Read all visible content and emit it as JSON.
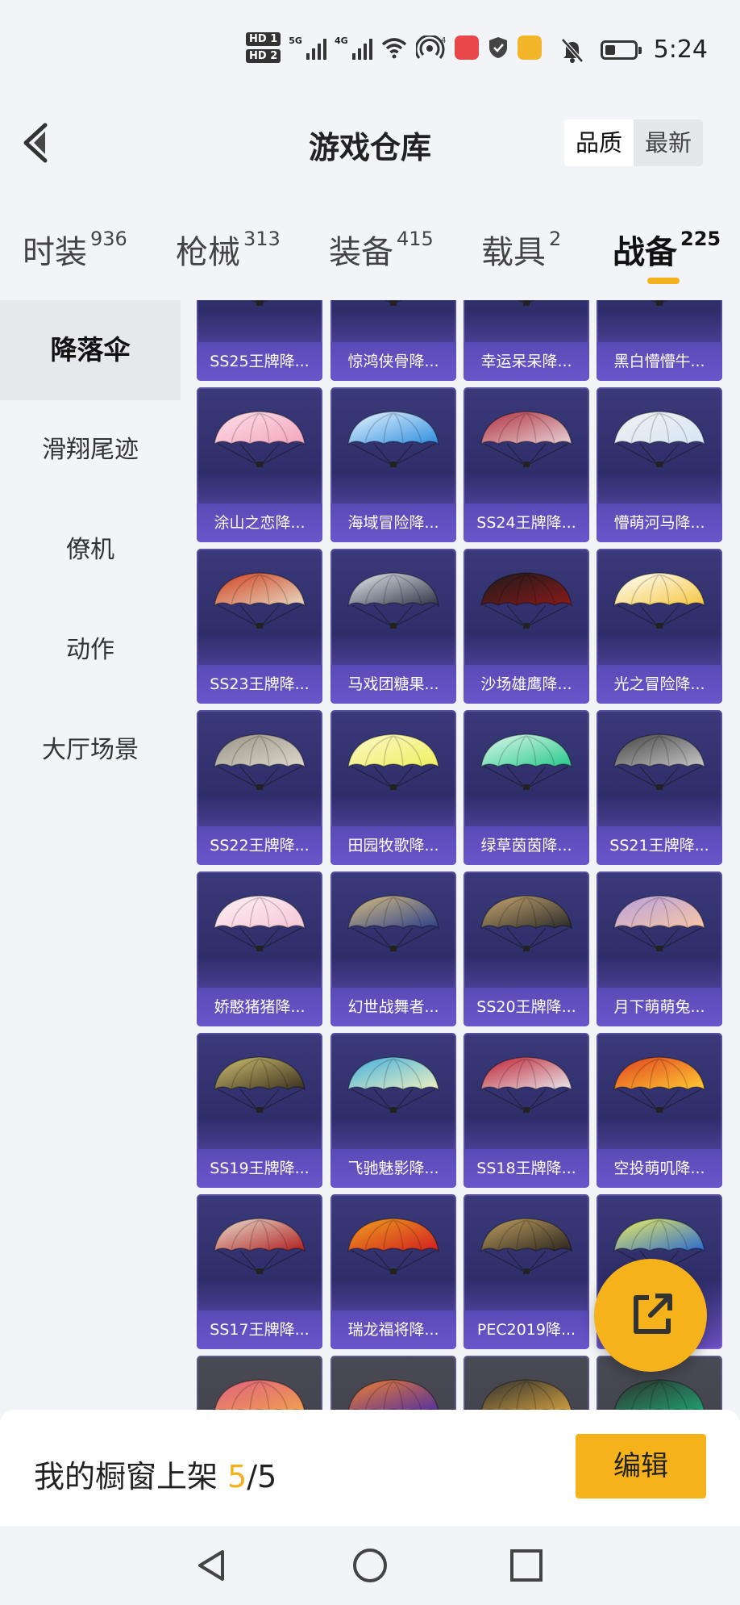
{
  "status_bar": {
    "time": "5:24",
    "hd1": "HD 1",
    "hd2": "HD 2",
    "net1": "5G",
    "net2": "4G"
  },
  "header": {
    "title": "游戏仓库",
    "sort": [
      "品质",
      "最新"
    ]
  },
  "tabs": [
    {
      "label": "时装",
      "count": "936"
    },
    {
      "label": "枪械",
      "count": "313"
    },
    {
      "label": "装备",
      "count": "415"
    },
    {
      "label": "载具",
      "count": "2"
    },
    {
      "label": "战备",
      "count": "225"
    }
  ],
  "side_menu": [
    "降落伞",
    "滑翔尾迹",
    "僚机",
    "动作",
    "大厅场景"
  ],
  "items": [
    {
      "name": "SS25王牌降...",
      "colors": [
        "#3a3a55",
        "#8a2030"
      ]
    },
    {
      "name": "惊鸿侠骨降...",
      "colors": [
        "#c02530",
        "#222"
      ]
    },
    {
      "name": "幸运呆呆降...",
      "colors": [
        "#e8e8e8",
        "#c04040"
      ]
    },
    {
      "name": "黑白懵懵牛...",
      "colors": [
        "#eee",
        "#222"
      ]
    },
    {
      "name": "涂山之恋降...",
      "colors": [
        "#f2a5bd",
        "#ffe0ea"
      ]
    },
    {
      "name": "海域冒险降...",
      "colors": [
        "#2f8fe0",
        "#eaf6ff"
      ]
    },
    {
      "name": "SS24王牌降...",
      "colors": [
        "#e9d3d6",
        "#b03040"
      ]
    },
    {
      "name": "懵萌河马降...",
      "colors": [
        "#d6e6f5",
        "#f1f1f1"
      ]
    },
    {
      "name": "SS23王牌降...",
      "colors": [
        "#e8d8c0",
        "#d04020"
      ]
    },
    {
      "name": "马戏团糖果...",
      "colors": [
        "#2c3545",
        "#e8ecf2"
      ]
    },
    {
      "name": "沙场雄鹰降...",
      "colors": [
        "#8a1a1a",
        "#1a1a1a"
      ]
    },
    {
      "name": "光之冒险降...",
      "colors": [
        "#f5c740",
        "#ffffff"
      ]
    },
    {
      "name": "SS22王牌降...",
      "colors": [
        "#ddd8cc",
        "#9a9488"
      ]
    },
    {
      "name": "田园牧歌降...",
      "colors": [
        "#eef060",
        "#fbf7c8"
      ]
    },
    {
      "name": "绿草茵茵降...",
      "colors": [
        "#27c98b",
        "#dff8ec"
      ]
    },
    {
      "name": "SS21王牌降...",
      "colors": [
        "#c8c8c8",
        "#444"
      ]
    },
    {
      "name": "娇憨猪猪降...",
      "colors": [
        "#f5c8d6",
        "#fff0f5"
      ]
    },
    {
      "name": "幻世战舞者...",
      "colors": [
        "#2d3f8a",
        "#d8c080"
      ]
    },
    {
      "name": "SS20王牌降...",
      "colors": [
        "#2a2a2a",
        "#c8a870"
      ]
    },
    {
      "name": "月下萌萌兔...",
      "colors": [
        "#f7c7a5",
        "#b8a0e0"
      ]
    },
    {
      "name": "SS19王牌降...",
      "colors": [
        "#3a3020",
        "#d0c070"
      ]
    },
    {
      "name": "飞驰魅影降...",
      "colors": [
        "#f0f0c0",
        "#40b0e0"
      ]
    },
    {
      "name": "SS18王牌降...",
      "colors": [
        "#e8e8ee",
        "#c02030"
      ]
    },
    {
      "name": "空投萌叽降...",
      "colors": [
        "#ffcc33",
        "#e04020"
      ]
    },
    {
      "name": "SS17王牌降...",
      "colors": [
        "#b02020",
        "#e8e0d0"
      ]
    },
    {
      "name": "瑞龙福将降...",
      "colors": [
        "#d02020",
        "#f0a020"
      ]
    },
    {
      "name": "PEC2019降...",
      "colors": [
        "#2a2520",
        "#c0a060"
      ]
    },
    {
      "name": "",
      "colors": [
        "#2a6ad0",
        "#f0f060"
      ]
    },
    {
      "name": "",
      "colors": [
        "#f0a050",
        "#e06080"
      ]
    },
    {
      "name": "",
      "colors": [
        "#5030a0",
        "#f08030"
      ]
    },
    {
      "name": "",
      "colors": [
        "#d0a040",
        "#303030"
      ]
    },
    {
      "name": "",
      "colors": [
        "#20a070",
        "#303030"
      ]
    }
  ],
  "bottom": {
    "label": "我的橱窗上架",
    "count": "5",
    "total": "/5",
    "edit": "编辑"
  }
}
